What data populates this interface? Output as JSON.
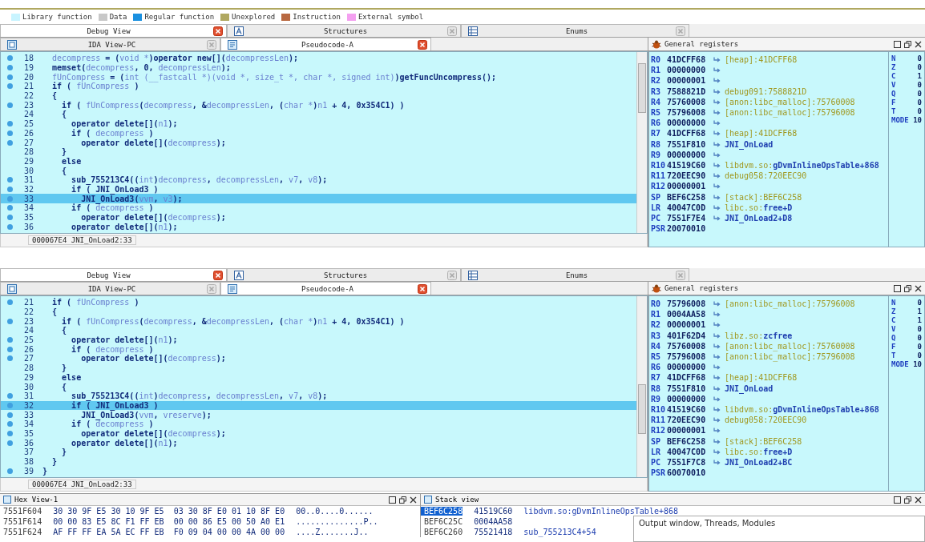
{
  "legend": [
    {
      "label": "Library function",
      "color": "#c8f4ff"
    },
    {
      "label": "Data",
      "color": "#c8c8c8"
    },
    {
      "label": "Regular function",
      "color": "#1a90e0"
    },
    {
      "label": "Unexplored",
      "color": "#b0a860"
    },
    {
      "label": "Instruction",
      "color": "#b86840"
    },
    {
      "label": "External symbol",
      "color": "#f4a0f0"
    }
  ],
  "panels": [
    {
      "tabs_top": [
        {
          "label": "Debug View",
          "kind": "plain",
          "selected": true
        },
        {
          "label": "Structures",
          "kind": "struct",
          "selected": false
        },
        {
          "label": "Enums",
          "kind": "enum",
          "selected": false
        }
      ],
      "tabs_code": [
        {
          "label": "IDA View-PC",
          "kind": "view",
          "selected": false
        },
        {
          "label": "Pseudocode-A",
          "kind": "pseudo",
          "selected": true
        }
      ],
      "lines": [
        {
          "num": "18",
          "bp": true,
          "selected": false,
          "parts": [
            {
              "t": "  decompress",
              "kind": "var"
            },
            {
              "t": " = ("
            },
            {
              "t": "void *",
              "kind": "var"
            },
            {
              "t": ")operator new[]("
            },
            {
              "t": "decompressLen",
              "kind": "var"
            },
            {
              "t": ");"
            }
          ]
        },
        {
          "num": "19",
          "bp": true,
          "selected": false,
          "parts": [
            {
              "t": "  memset("
            },
            {
              "t": "decompress",
              "kind": "var"
            },
            {
              "t": ", 0, "
            },
            {
              "t": "decompressLen",
              "kind": "var"
            },
            {
              "t": ");"
            }
          ]
        },
        {
          "num": "20",
          "bp": true,
          "selected": false,
          "parts": [
            {
              "t": "  fUnCompress",
              "kind": "var"
            },
            {
              "t": " = ("
            },
            {
              "t": "int (__fastcall *)(void *, size_t *, char *, signed int)",
              "kind": "var"
            },
            {
              "t": ")getFuncUncompress();"
            }
          ]
        },
        {
          "num": "21",
          "bp": true,
          "selected": false,
          "parts": [
            {
              "t": "  if ( "
            },
            {
              "t": "fUnCompress",
              "kind": "var"
            },
            {
              "t": " )"
            }
          ]
        },
        {
          "num": "22",
          "bp": false,
          "selected": false,
          "parts": [
            {
              "t": "  {"
            }
          ]
        },
        {
          "num": "23",
          "bp": true,
          "selected": false,
          "parts": [
            {
              "t": "    if ( "
            },
            {
              "t": "fUnCompress",
              "kind": "var"
            },
            {
              "t": "("
            },
            {
              "t": "decompress",
              "kind": "var"
            },
            {
              "t": ", &"
            },
            {
              "t": "decompressLen",
              "kind": "var"
            },
            {
              "t": ", ("
            },
            {
              "t": "char *",
              "kind": "var"
            },
            {
              "t": ")"
            },
            {
              "t": "n1",
              "kind": "var"
            },
            {
              "t": " + 4, 0x354C1) )"
            }
          ]
        },
        {
          "num": "24",
          "bp": false,
          "selected": false,
          "parts": [
            {
              "t": "    {"
            }
          ]
        },
        {
          "num": "25",
          "bp": true,
          "selected": false,
          "parts": [
            {
              "t": "      operator delete[]("
            },
            {
              "t": "n1",
              "kind": "var"
            },
            {
              "t": ");"
            }
          ]
        },
        {
          "num": "26",
          "bp": true,
          "selected": false,
          "parts": [
            {
              "t": "      if ( "
            },
            {
              "t": "decompress",
              "kind": "var"
            },
            {
              "t": " )"
            }
          ]
        },
        {
          "num": "27",
          "bp": true,
          "selected": false,
          "parts": [
            {
              "t": "        operator delete[]("
            },
            {
              "t": "decompress",
              "kind": "var"
            },
            {
              "t": ");"
            }
          ]
        },
        {
          "num": "28",
          "bp": false,
          "selected": false,
          "parts": [
            {
              "t": "    }"
            }
          ]
        },
        {
          "num": "29",
          "bp": false,
          "selected": false,
          "parts": [
            {
              "t": "    else"
            }
          ]
        },
        {
          "num": "30",
          "bp": false,
          "selected": false,
          "parts": [
            {
              "t": "    {"
            }
          ]
        },
        {
          "num": "31",
          "bp": true,
          "selected": false,
          "parts": [
            {
              "t": "      sub_755213C4(("
            },
            {
              "t": "int",
              "kind": "var"
            },
            {
              "t": ")"
            },
            {
              "t": "decompress",
              "kind": "var"
            },
            {
              "t": ", "
            },
            {
              "t": "decompressLen",
              "kind": "var"
            },
            {
              "t": ", "
            },
            {
              "t": "v7",
              "kind": "var"
            },
            {
              "t": ", "
            },
            {
              "t": "v8",
              "kind": "var"
            },
            {
              "t": ");"
            }
          ]
        },
        {
          "num": "32",
          "bp": true,
          "selected": false,
          "parts": [
            {
              "t": "      if ( JNI_OnLoad3 )"
            }
          ]
        },
        {
          "num": "33",
          "bp": true,
          "selected": true,
          "parts": [
            {
              "t": "        JNI_OnLoad3("
            },
            {
              "t": "vvm",
              "kind": "var"
            },
            {
              "t": ", "
            },
            {
              "t": "v3",
              "kind": "var"
            },
            {
              "t": ");"
            }
          ]
        },
        {
          "num": "34",
          "bp": true,
          "selected": false,
          "parts": [
            {
              "t": "      if ( "
            },
            {
              "t": "decompress",
              "kind": "var"
            },
            {
              "t": " )"
            }
          ]
        },
        {
          "num": "35",
          "bp": true,
          "selected": false,
          "parts": [
            {
              "t": "        operator delete[]("
            },
            {
              "t": "decompress",
              "kind": "var"
            },
            {
              "t": ");"
            }
          ]
        },
        {
          "num": "36",
          "bp": true,
          "selected": false,
          "parts": [
            {
              "t": "      operator delete[]("
            },
            {
              "t": "n1",
              "kind": "var"
            },
            {
              "t": ");"
            }
          ]
        }
      ],
      "status": "000067E4 JNI_OnLoad2:33",
      "registers": {
        "title": "General registers",
        "rows": [
          {
            "name": "R0",
            "value": "41DCFF68",
            "arrow": true,
            "target": "[heap]:41DCFF68"
          },
          {
            "name": "R1",
            "value": "00000000",
            "arrow": true
          },
          {
            "name": "R2",
            "value": "00000001",
            "arrow": true
          },
          {
            "name": "R3",
            "value": "7588821D",
            "arrow": true,
            "target": "debug091:7588821D"
          },
          {
            "name": "R4",
            "value": "75760008",
            "arrow": true,
            "target": "[anon:libc_malloc]:75760008"
          },
          {
            "name": "R5",
            "value": "75796008",
            "arrow": true,
            "target": "[anon:libc_malloc]:75796008"
          },
          {
            "name": "R6",
            "value": "00000000",
            "arrow": true
          },
          {
            "name": "R7",
            "value": "41DCFF68",
            "arrow": true,
            "target": "[heap]:41DCFF68"
          },
          {
            "name": "R8",
            "value": "7551F810",
            "arrow": true,
            "symbol": "JNI_OnLoad"
          },
          {
            "name": "R9",
            "value": "00000000",
            "arrow": true
          },
          {
            "name": "R10",
            "value": "41519C60",
            "arrow": true,
            "target": "libdvm.so:",
            "symbol": "gDvmInlineOpsTable+868"
          },
          {
            "name": "R11",
            "value": "720EEC90",
            "arrow": true,
            "target": "debug058:720EEC90"
          },
          {
            "name": "R12",
            "value": "00000001",
            "arrow": true
          },
          {
            "name": "SP",
            "value": "BEF6C258",
            "arrow": true,
            "target": "[stack]:BEF6C258"
          },
          {
            "name": "LR",
            "value": "40047C0D",
            "arrow": true,
            "target": "libc.so:",
            "symbol": "free+D"
          },
          {
            "name": "PC",
            "value": "7551F7E4",
            "arrow": true,
            "symbol": "JNI_OnLoad2+D8"
          },
          {
            "name": "PSR",
            "value": "20070010",
            "arrow": false
          }
        ],
        "flags": [
          {
            "name": "N",
            "value": "0"
          },
          {
            "name": "Z",
            "value": "0"
          },
          {
            "name": "C",
            "value": "1"
          },
          {
            "name": "V",
            "value": "0"
          },
          {
            "name": "Q",
            "value": "0"
          },
          {
            "name": "F",
            "value": "0"
          },
          {
            "name": "T",
            "value": "0"
          },
          {
            "name": "MODE",
            "value": "10"
          }
        ]
      }
    },
    {
      "tabs_top": [
        {
          "label": "Debug View",
          "kind": "plain",
          "selected": true
        },
        {
          "label": "Structures",
          "kind": "struct",
          "selected": false
        },
        {
          "label": "Enums",
          "kind": "enum",
          "selected": false
        }
      ],
      "tabs_code": [
        {
          "label": "IDA View-PC",
          "kind": "view",
          "selected": false
        },
        {
          "label": "Pseudocode-A",
          "kind": "pseudo",
          "selected": true
        }
      ],
      "lines": [
        {
          "num": "21",
          "bp": true,
          "selected": false,
          "parts": [
            {
              "t": "  if ( "
            },
            {
              "t": "fUnCompress",
              "kind": "var"
            },
            {
              "t": " )"
            }
          ]
        },
        {
          "num": "22",
          "bp": false,
          "selected": false,
          "parts": [
            {
              "t": "  {"
            }
          ]
        },
        {
          "num": "23",
          "bp": true,
          "selected": false,
          "parts": [
            {
              "t": "    if ( "
            },
            {
              "t": "fUnCompress",
              "kind": "var"
            },
            {
              "t": "("
            },
            {
              "t": "decompress",
              "kind": "var"
            },
            {
              "t": ", &"
            },
            {
              "t": "decompressLen",
              "kind": "var"
            },
            {
              "t": ", ("
            },
            {
              "t": "char *",
              "kind": "var"
            },
            {
              "t": ")"
            },
            {
              "t": "n1",
              "kind": "var"
            },
            {
              "t": " + 4, 0x354C1) )"
            }
          ]
        },
        {
          "num": "24",
          "bp": false,
          "selected": false,
          "parts": [
            {
              "t": "    {"
            }
          ]
        },
        {
          "num": "25",
          "bp": true,
          "selected": false,
          "parts": [
            {
              "t": "      operator delete[]("
            },
            {
              "t": "n1",
              "kind": "var"
            },
            {
              "t": ");"
            }
          ]
        },
        {
          "num": "26",
          "bp": true,
          "selected": false,
          "parts": [
            {
              "t": "      if ( "
            },
            {
              "t": "decompress",
              "kind": "var"
            },
            {
              "t": " )"
            }
          ]
        },
        {
          "num": "27",
          "bp": true,
          "selected": false,
          "parts": [
            {
              "t": "        operator delete[]("
            },
            {
              "t": "decompress",
              "kind": "var"
            },
            {
              "t": ");"
            }
          ]
        },
        {
          "num": "28",
          "bp": false,
          "selected": false,
          "parts": [
            {
              "t": "    }"
            }
          ]
        },
        {
          "num": "29",
          "bp": false,
          "selected": false,
          "parts": [
            {
              "t": "    else"
            }
          ]
        },
        {
          "num": "30",
          "bp": false,
          "selected": false,
          "parts": [
            {
              "t": "    {"
            }
          ]
        },
        {
          "num": "31",
          "bp": true,
          "selected": false,
          "parts": [
            {
              "t": "      sub_755213C4(("
            },
            {
              "t": "int",
              "kind": "var"
            },
            {
              "t": ")"
            },
            {
              "t": "decompress",
              "kind": "var"
            },
            {
              "t": ", "
            },
            {
              "t": "decompressLen",
              "kind": "var"
            },
            {
              "t": ", "
            },
            {
              "t": "v7",
              "kind": "var"
            },
            {
              "t": ", "
            },
            {
              "t": "v8",
              "kind": "var"
            },
            {
              "t": ");"
            }
          ]
        },
        {
          "num": "32",
          "bp": true,
          "selected": true,
          "parts": [
            {
              "t": "      if ( JNI_OnLoad3 )"
            }
          ]
        },
        {
          "num": "33",
          "bp": true,
          "selected": false,
          "parts": [
            {
              "t": "        JNI_OnLoad3("
            },
            {
              "t": "vvm",
              "kind": "var"
            },
            {
              "t": ", "
            },
            {
              "t": "vreserve",
              "kind": "var"
            },
            {
              "t": ");"
            }
          ]
        },
        {
          "num": "34",
          "bp": true,
          "selected": false,
          "parts": [
            {
              "t": "      if ( "
            },
            {
              "t": "decompress",
              "kind": "var"
            },
            {
              "t": " )"
            }
          ]
        },
        {
          "num": "35",
          "bp": true,
          "selected": false,
          "parts": [
            {
              "t": "        operator delete[]("
            },
            {
              "t": "decompress",
              "kind": "var"
            },
            {
              "t": ");"
            }
          ]
        },
        {
          "num": "36",
          "bp": true,
          "selected": false,
          "parts": [
            {
              "t": "      operator delete[]("
            },
            {
              "t": "n1",
              "kind": "var"
            },
            {
              "t": ");"
            }
          ]
        },
        {
          "num": "37",
          "bp": false,
          "selected": false,
          "parts": [
            {
              "t": "    }"
            }
          ]
        },
        {
          "num": "38",
          "bp": false,
          "selected": false,
          "parts": [
            {
              "t": "  }"
            }
          ]
        },
        {
          "num": "39",
          "bp": true,
          "selected": false,
          "parts": [
            {
              "t": "}"
            }
          ]
        }
      ],
      "status": "000067E4 JNI_OnLoad2:33",
      "registers": {
        "title": "General registers",
        "rows": [
          {
            "name": "R0",
            "value": "75796008",
            "arrow": true,
            "target": "[anon:libc_malloc]:75796008"
          },
          {
            "name": "R1",
            "value": "0004AA58",
            "arrow": true
          },
          {
            "name": "R2",
            "value": "00000001",
            "arrow": true
          },
          {
            "name": "R3",
            "value": "401F62D4",
            "arrow": true,
            "target": "libz.so:",
            "symbol": "zcfree"
          },
          {
            "name": "R4",
            "value": "75760008",
            "arrow": true,
            "target": "[anon:libc_malloc]:75760008"
          },
          {
            "name": "R5",
            "value": "75796008",
            "arrow": true,
            "target": "[anon:libc_malloc]:75796008"
          },
          {
            "name": "R6",
            "value": "00000000",
            "arrow": true
          },
          {
            "name": "R7",
            "value": "41DCFF68",
            "arrow": true,
            "target": "[heap]:41DCFF68"
          },
          {
            "name": "R8",
            "value": "7551F810",
            "arrow": true,
            "symbol": "JNI_OnLoad"
          },
          {
            "name": "R9",
            "value": "00000000",
            "arrow": true
          },
          {
            "name": "R10",
            "value": "41519C60",
            "arrow": true,
            "target": "libdvm.so:",
            "symbol": "gDvmInlineOpsTable+868"
          },
          {
            "name": "R11",
            "value": "720EEC90",
            "arrow": true,
            "target": "debug058:720EEC90"
          },
          {
            "name": "R12",
            "value": "00000001",
            "arrow": true
          },
          {
            "name": "SP",
            "value": "BEF6C258",
            "arrow": true,
            "target": "[stack]:BEF6C258"
          },
          {
            "name": "LR",
            "value": "40047C0D",
            "arrow": true,
            "target": "libc.so:",
            "symbol": "free+D"
          },
          {
            "name": "PC",
            "value": "7551F7C8",
            "arrow": true,
            "symbol": "JNI_OnLoad2+BC"
          },
          {
            "name": "PSR",
            "value": "60070010",
            "arrow": false
          }
        ],
        "flags": [
          {
            "name": "N",
            "value": "0"
          },
          {
            "name": "Z",
            "value": "1"
          },
          {
            "name": "C",
            "value": "1"
          },
          {
            "name": "V",
            "value": "0"
          },
          {
            "name": "Q",
            "value": "0"
          },
          {
            "name": "F",
            "value": "0"
          },
          {
            "name": "T",
            "value": "0"
          },
          {
            "name": "MODE",
            "value": "10"
          }
        ]
      }
    }
  ],
  "hex_view": {
    "title": "Hex View-1",
    "rows": [
      {
        "address": "7551F604",
        "bytes": "30 30 9F E5 30 10 9F E5  03 30 8F E0 01 10 8F E0",
        "ascii": "00..0....0......"
      },
      {
        "address": "7551F614",
        "bytes": "00 00 83 E5 8C F1 FF EB  00 00 86 E5 00 50 A0 E1",
        "ascii": "..............P.."
      },
      {
        "address": "7551F624",
        "bytes": "AF FF FF EA 5A EC FF EB  F0 09 04 00 00 4A 00 00",
        "ascii": "....Z.......J.."
      }
    ]
  },
  "stack_view": {
    "title": "Stack view",
    "rows": [
      {
        "address": "BEF6C258",
        "value": "41519C60",
        "symbol": "libdvm.so:gDvmInlineOpsTable+868",
        "selected": true
      },
      {
        "address": "BEF6C25C",
        "value": "0004AA58",
        "selected": false
      },
      {
        "address": "BEF6C260",
        "value": "75521418",
        "symbol": "sub_755213C4+54",
        "selected": false
      }
    ]
  },
  "tooltip": "Output window, Threads, Modules"
}
